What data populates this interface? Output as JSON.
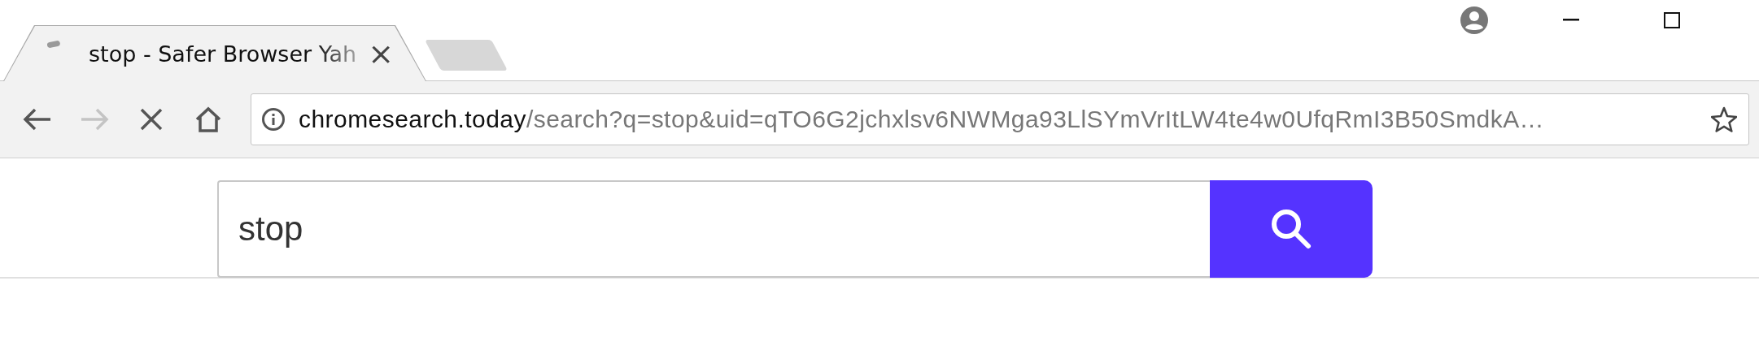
{
  "tabs": [
    {
      "title": "stop - Safer Browser Yah",
      "selected": true,
      "loading": true,
      "close": "×"
    }
  ],
  "toolbar": {
    "buttons": [
      {
        "kind": "back",
        "disabled": false
      },
      {
        "kind": "forward",
        "disabled": true
      },
      {
        "kind": "stop",
        "disabled": false
      },
      {
        "kind": "home",
        "disabled": false
      }
    ]
  },
  "address_bar": {
    "host": "chromesearch.today",
    "path": "/search?q=stop&uid=qTO6G2jchxlsv6NWMga93LlSYmVrItLW4te4w0UfqRmI3B50SmdkA…",
    "bookmarked": false
  },
  "search": {
    "value": "stop"
  }
}
